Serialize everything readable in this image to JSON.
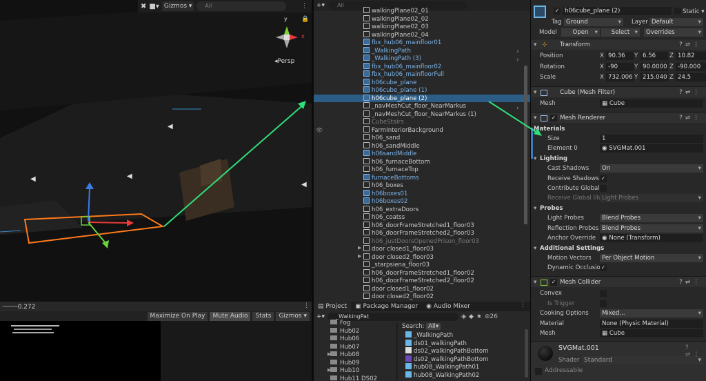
{
  "scene": {
    "toolbar": {
      "gizmos": "Gizmos",
      "search_placeholder": "All"
    },
    "persp": "Persp",
    "axis_y": "y",
    "axis_x": "x"
  },
  "game": {
    "scale_value": "0.272",
    "buttons": [
      "Maximize On Play",
      "Mute Audio",
      "Stats",
      "Gizmos"
    ]
  },
  "hierarchy": {
    "search_placeholder": "All",
    "rows": [
      {
        "label": "walkingPlane02_01",
        "style": "normal"
      },
      {
        "label": "walkingPlane02_02",
        "style": "normal"
      },
      {
        "label": "walkingPlane02_03",
        "style": "normal"
      },
      {
        "label": "walkingPlane02_04",
        "style": "normal"
      },
      {
        "label": "fbx_hub06_mainfloor01",
        "style": "blue"
      },
      {
        "label": "_WalkingPath",
        "style": "blue"
      },
      {
        "label": "_WalkingPath (3)",
        "style": "blue"
      },
      {
        "label": "fbx_hub06_mainfloor02",
        "style": "blue"
      },
      {
        "label": "fbx_hub06_mainfloorFull",
        "style": "blue"
      },
      {
        "label": "h06cube_plane",
        "style": "blue"
      },
      {
        "label": "h06cube_plane (1)",
        "style": "blue"
      },
      {
        "label": "h06cube_plane (2)",
        "style": "selected"
      },
      {
        "label": "_navMeshCut_floor_NearMarkus",
        "style": "normal"
      },
      {
        "label": "_navMeshCut_floor_NearMarkus (1)",
        "style": "normal"
      },
      {
        "label": "CubeStairs",
        "style": "grey"
      },
      {
        "label": "FarmInteriorBackground",
        "style": "normal"
      },
      {
        "label": "h06_sand",
        "style": "normal"
      },
      {
        "label": "h06_sandMiddle",
        "style": "normal"
      },
      {
        "label": "h06sandMiddle",
        "style": "blue"
      },
      {
        "label": "h06_furnaceBottom",
        "style": "normal"
      },
      {
        "label": "h06_furnaceTop",
        "style": "normal"
      },
      {
        "label": "furnaceBottoms",
        "style": "blue"
      },
      {
        "label": "h06_boxes",
        "style": "normal"
      },
      {
        "label": "h06boxes01",
        "style": "blue"
      },
      {
        "label": "h06boxes02",
        "style": "blue"
      },
      {
        "label": "h06_extraDoors",
        "style": "normal"
      },
      {
        "label": "h06_coatss",
        "style": "normal"
      },
      {
        "label": "h06_doorFrameStretched1_floor03",
        "style": "normal"
      },
      {
        "label": "h06_doorFrameStretched2_floor03",
        "style": "normal"
      },
      {
        "label": "h06_justDoorsOpenedPrison_floor03",
        "style": "grey"
      },
      {
        "label": "door closed1_floor03",
        "style": "normal"
      },
      {
        "label": "door closed2_floor03",
        "style": "normal"
      },
      {
        "label": "_starpsiena_floor03",
        "style": "normal"
      },
      {
        "label": "h06_doorFrameStretched1_floor02",
        "style": "normal"
      },
      {
        "label": "h06_doorFrameStretched2_floor02",
        "style": "normal"
      },
      {
        "label": "door closed1_floor02",
        "style": "normal"
      },
      {
        "label": "door closed2_floor02",
        "style": "normal"
      }
    ]
  },
  "project": {
    "tabs": [
      "Project",
      "Package Manager",
      "Audio Mixer"
    ],
    "search_value": "_WalkingPat",
    "count": "26",
    "search_label": "Search:",
    "search_scope": "All",
    "folders": [
      "Fog",
      "Hub02",
      "Hub06",
      "Hub07",
      "Hub08",
      "Hub09",
      "Hub10",
      "Hub11 DS02"
    ],
    "assets": [
      "_WalkingPath",
      "ds01_walkingPath",
      "ds02_walkingPathBottom",
      "ds02_walkingPathBottom",
      "hub08_WalkingPath01",
      "hub08_WalkingPath02"
    ]
  },
  "inspector": {
    "name": "h06cube_plane (2)",
    "static_label": "Static",
    "tag_label": "Tag",
    "tag_value": "Ground",
    "layer_label": "Layer",
    "layer_value": "Default",
    "model_label": "Model",
    "model_buttons": [
      "Open",
      "Select",
      "Overrides"
    ],
    "transform": {
      "title": "Transform",
      "position": {
        "label": "Position",
        "x": "90.36",
        "y": "6.56",
        "z": "10.82"
      },
      "rotation": {
        "label": "Rotation",
        "x": "-90",
        "y": "90.0000",
        "z": "-90.000"
      },
      "scale": {
        "label": "Scale",
        "x": "732.006",
        "y": "215.040",
        "z": "24.5"
      },
      "axis_x": "X",
      "axis_y": "Y",
      "axis_z": "Z"
    },
    "mesh_filter": {
      "title": "Cube (Mesh Filter)",
      "mesh_label": "Mesh",
      "mesh_value": "Cube"
    },
    "mesh_renderer": {
      "title": "Mesh Renderer",
      "materials_label": "Materials",
      "size_label": "Size",
      "size_value": "1",
      "element0_label": "Element 0",
      "element0_value": "SVGMat.001",
      "lighting_label": "Lighting",
      "cast_shadows_label": "Cast Shadows",
      "cast_shadows_value": "On",
      "receive_shadows_label": "Receive Shadows",
      "contribute_gi_label": "Contribute Global I",
      "receive_gi_label": "Receive Global Illu",
      "receive_gi_value": "Light Probes",
      "probes_label": "Probes",
      "light_probes_label": "Light Probes",
      "light_probes_value": "Blend Probes",
      "reflection_probes_label": "Reflection Probes",
      "reflection_probes_value": "Blend Probes",
      "anchor_override_label": "Anchor Override",
      "anchor_override_value": "None (Transform)",
      "additional_label": "Additional Settings",
      "motion_vectors_label": "Motion Vectors",
      "motion_vectors_value": "Per Object Motion",
      "dynamic_occlusion_label": "Dynamic Occlusio"
    },
    "mesh_collider": {
      "title": "Mesh Collider",
      "convex_label": "Convex",
      "is_trigger_label": "Is Trigger",
      "cooking_label": "Cooking Options",
      "cooking_value": "Mixed...",
      "material_label": "Material",
      "material_value": "None (Physic Material)",
      "mesh_label": "Mesh",
      "mesh_value": "Cube"
    },
    "material": {
      "name": "SVGMat.001",
      "shader_label": "Shader",
      "shader_value": "Standard",
      "addressable_label": "Addressable"
    }
  },
  "colors": {
    "selection": "#2c5d87",
    "annotation_arrow": "#2ee07a",
    "selected_outline": "#ff7a1a",
    "prefab_blue": "#7cb4ea"
  }
}
